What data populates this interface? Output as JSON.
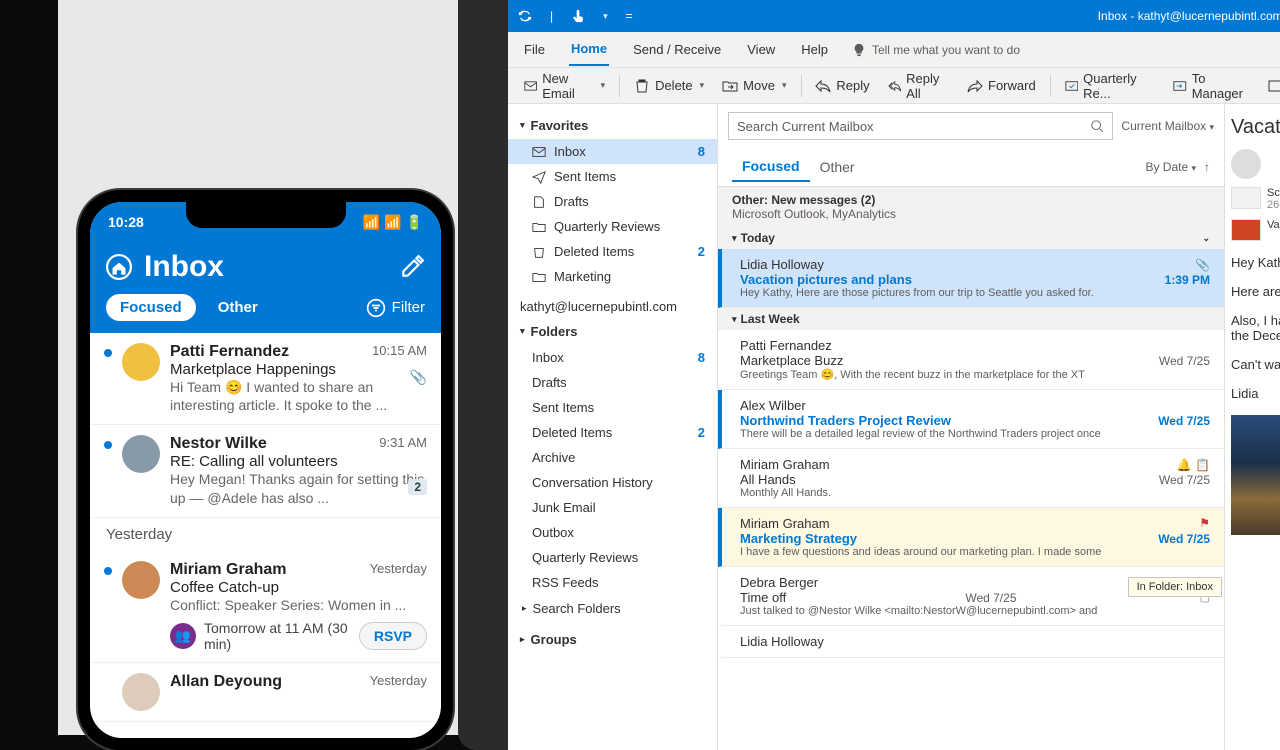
{
  "desktop": {
    "title": "Inbox - kathyt@lucernepubintl.com -",
    "menus": [
      "File",
      "Home",
      "Send / Receive",
      "View",
      "Help"
    ],
    "tell_me": "Tell me what you want to do",
    "ribbon": {
      "new_email": "New Email",
      "delete": "Delete",
      "move": "Move",
      "reply": "Reply",
      "reply_all": "Reply All",
      "forward": "Forward",
      "quarterly": "Quarterly Re...",
      "to_manager": "To Manager"
    },
    "nav": {
      "favorites": "Favorites",
      "fav_items": [
        {
          "label": "Inbox",
          "count": "8",
          "sel": true
        },
        {
          "label": "Sent Items"
        },
        {
          "label": "Drafts"
        },
        {
          "label": "Quarterly Reviews"
        },
        {
          "label": "Deleted Items",
          "count": "2"
        },
        {
          "label": "Marketing"
        }
      ],
      "account": "kathyt@lucernepubintl.com",
      "folders": "Folders",
      "folder_items": [
        {
          "label": "Inbox",
          "count": "8"
        },
        {
          "label": "Drafts"
        },
        {
          "label": "Sent Items"
        },
        {
          "label": "Deleted Items",
          "count": "2"
        },
        {
          "label": "Archive"
        },
        {
          "label": "Conversation History"
        },
        {
          "label": "Junk Email"
        },
        {
          "label": "Outbox"
        },
        {
          "label": "Quarterly Reviews"
        },
        {
          "label": "RSS Feeds"
        }
      ],
      "search_folders": "Search Folders",
      "groups": "Groups"
    },
    "search": {
      "placeholder": "Search Current Mailbox",
      "scope": "Current Mailbox"
    },
    "tabs": {
      "focused": "Focused",
      "other": "Other",
      "sort": "By Date"
    },
    "other_bar": {
      "title": "Other: New messages (2)",
      "sub": "Microsoft Outlook, MyAnalytics"
    },
    "groups_list": {
      "today": "Today",
      "last_week": "Last Week"
    },
    "messages_today": [
      {
        "from": "Lidia Holloway",
        "subj": "Vacation pictures and plans",
        "prev": "Hey Kathy,  Here are those pictures from our trip to Seattle you asked for.",
        "date": "1:39 PM",
        "unread": true,
        "sel": true,
        "att": true
      }
    ],
    "messages_lw": [
      {
        "from": "Patti Fernandez",
        "subj": "Marketplace Buzz",
        "prev": "Greetings Team 😊,   With the recent buzz in the marketplace for the XT",
        "date": "Wed 7/25"
      },
      {
        "from": "Alex Wilber",
        "subj": "Northwind Traders Project Review",
        "prev": "There will be a detailed legal review of the Northwind Traders project once",
        "date": "Wed 7/25",
        "unread": true
      },
      {
        "from": "Miriam Graham",
        "subj": "All Hands",
        "prev": "Monthly All Hands.",
        "date": "Wed 7/25",
        "bell": true
      },
      {
        "from": "Miriam Graham",
        "subj": "Marketing Strategy",
        "prev": "I have a few questions and ideas around our marketing plan.  I made some",
        "date": "Wed 7/25",
        "unread": true,
        "flag": true
      },
      {
        "from": "Debra Berger",
        "subj": "Time off",
        "prev": "Just talked to @Nestor Wilke <mailto:NestorW@lucernepubintl.com>  and",
        "date": "Wed 7/25",
        "flag_outline": true
      },
      {
        "from": "Lidia Holloway",
        "subj": "",
        "prev": "",
        "date": ""
      }
    ],
    "reading": {
      "subject": "Vacati",
      "att1": "Sc",
      "att1b": "26",
      "att2": "Va",
      "p1": "Hey Kath",
      "p2": "Here are",
      "p3": "Also, I ha",
      "p3b": "the Dece",
      "p4": "Can't wa",
      "p5": "Lidia"
    },
    "tooltip": "In Folder: Inbox"
  },
  "phone": {
    "time": "10:28",
    "title": "Inbox",
    "tabs": {
      "focused": "Focused",
      "other": "Other",
      "filter": "Filter"
    },
    "items": [
      {
        "name": "Patti Fernandez",
        "time": "10:15 AM",
        "subj": "Marketplace Happenings",
        "prev": "Hi Team 😊 I wanted to share an interesting article. It spoke to the ...",
        "att": true,
        "dot": true
      },
      {
        "name": "Nestor Wilke",
        "time": "9:31 AM",
        "subj": "RE: Calling all volunteers",
        "prev": "Hey Megan! Thanks again for setting this up — @Adele has also ...",
        "badge": "2",
        "dot": true
      }
    ],
    "yesterday": "Yesterday",
    "items2": [
      {
        "name": "Miriam Graham",
        "time": "Yesterday",
        "subj": "Coffee Catch-up",
        "prev": "Conflict: Speaker Series: Women in ...",
        "meeting": "Tomorrow at 11 AM (30 min)",
        "rsvp": "RSVP",
        "dot": true
      },
      {
        "name": "Allan Deyoung",
        "time": "Yesterday"
      }
    ]
  }
}
